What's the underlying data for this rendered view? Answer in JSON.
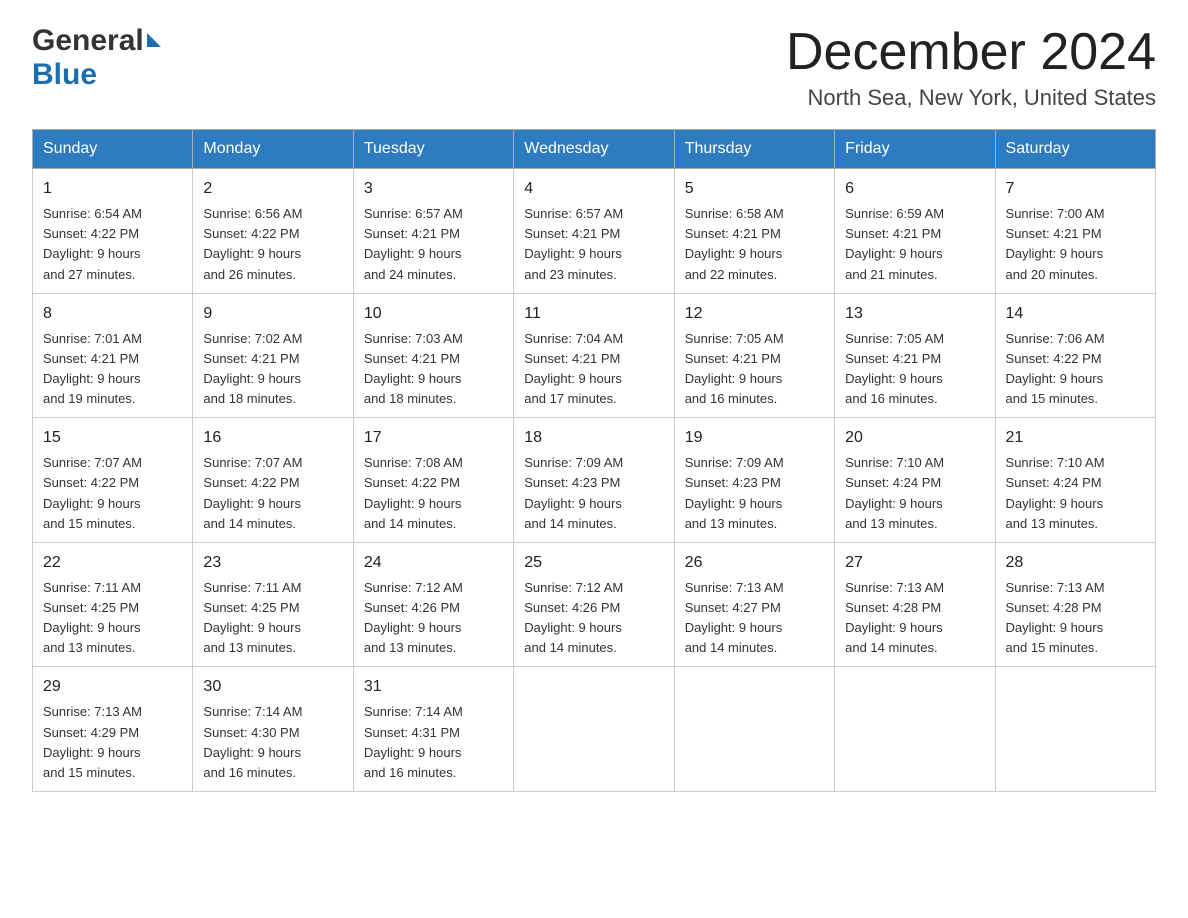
{
  "header": {
    "title": "December 2024",
    "subtitle": "North Sea, New York, United States",
    "logo_general": "General",
    "logo_blue": "Blue"
  },
  "days_of_week": [
    "Sunday",
    "Monday",
    "Tuesday",
    "Wednesday",
    "Thursday",
    "Friday",
    "Saturday"
  ],
  "weeks": [
    [
      {
        "day": "1",
        "sunrise": "6:54 AM",
        "sunset": "4:22 PM",
        "daylight": "9 hours and 27 minutes."
      },
      {
        "day": "2",
        "sunrise": "6:56 AM",
        "sunset": "4:22 PM",
        "daylight": "9 hours and 26 minutes."
      },
      {
        "day": "3",
        "sunrise": "6:57 AM",
        "sunset": "4:21 PM",
        "daylight": "9 hours and 24 minutes."
      },
      {
        "day": "4",
        "sunrise": "6:57 AM",
        "sunset": "4:21 PM",
        "daylight": "9 hours and 23 minutes."
      },
      {
        "day": "5",
        "sunrise": "6:58 AM",
        "sunset": "4:21 PM",
        "daylight": "9 hours and 22 minutes."
      },
      {
        "day": "6",
        "sunrise": "6:59 AM",
        "sunset": "4:21 PM",
        "daylight": "9 hours and 21 minutes."
      },
      {
        "day": "7",
        "sunrise": "7:00 AM",
        "sunset": "4:21 PM",
        "daylight": "9 hours and 20 minutes."
      }
    ],
    [
      {
        "day": "8",
        "sunrise": "7:01 AM",
        "sunset": "4:21 PM",
        "daylight": "9 hours and 19 minutes."
      },
      {
        "day": "9",
        "sunrise": "7:02 AM",
        "sunset": "4:21 PM",
        "daylight": "9 hours and 18 minutes."
      },
      {
        "day": "10",
        "sunrise": "7:03 AM",
        "sunset": "4:21 PM",
        "daylight": "9 hours and 18 minutes."
      },
      {
        "day": "11",
        "sunrise": "7:04 AM",
        "sunset": "4:21 PM",
        "daylight": "9 hours and 17 minutes."
      },
      {
        "day": "12",
        "sunrise": "7:05 AM",
        "sunset": "4:21 PM",
        "daylight": "9 hours and 16 minutes."
      },
      {
        "day": "13",
        "sunrise": "7:05 AM",
        "sunset": "4:21 PM",
        "daylight": "9 hours and 16 minutes."
      },
      {
        "day": "14",
        "sunrise": "7:06 AM",
        "sunset": "4:22 PM",
        "daylight": "9 hours and 15 minutes."
      }
    ],
    [
      {
        "day": "15",
        "sunrise": "7:07 AM",
        "sunset": "4:22 PM",
        "daylight": "9 hours and 15 minutes."
      },
      {
        "day": "16",
        "sunrise": "7:07 AM",
        "sunset": "4:22 PM",
        "daylight": "9 hours and 14 minutes."
      },
      {
        "day": "17",
        "sunrise": "7:08 AM",
        "sunset": "4:22 PM",
        "daylight": "9 hours and 14 minutes."
      },
      {
        "day": "18",
        "sunrise": "7:09 AM",
        "sunset": "4:23 PM",
        "daylight": "9 hours and 14 minutes."
      },
      {
        "day": "19",
        "sunrise": "7:09 AM",
        "sunset": "4:23 PM",
        "daylight": "9 hours and 13 minutes."
      },
      {
        "day": "20",
        "sunrise": "7:10 AM",
        "sunset": "4:24 PM",
        "daylight": "9 hours and 13 minutes."
      },
      {
        "day": "21",
        "sunrise": "7:10 AM",
        "sunset": "4:24 PM",
        "daylight": "9 hours and 13 minutes."
      }
    ],
    [
      {
        "day": "22",
        "sunrise": "7:11 AM",
        "sunset": "4:25 PM",
        "daylight": "9 hours and 13 minutes."
      },
      {
        "day": "23",
        "sunrise": "7:11 AM",
        "sunset": "4:25 PM",
        "daylight": "9 hours and 13 minutes."
      },
      {
        "day": "24",
        "sunrise": "7:12 AM",
        "sunset": "4:26 PM",
        "daylight": "9 hours and 13 minutes."
      },
      {
        "day": "25",
        "sunrise": "7:12 AM",
        "sunset": "4:26 PM",
        "daylight": "9 hours and 14 minutes."
      },
      {
        "day": "26",
        "sunrise": "7:13 AM",
        "sunset": "4:27 PM",
        "daylight": "9 hours and 14 minutes."
      },
      {
        "day": "27",
        "sunrise": "7:13 AM",
        "sunset": "4:28 PM",
        "daylight": "9 hours and 14 minutes."
      },
      {
        "day": "28",
        "sunrise": "7:13 AM",
        "sunset": "4:28 PM",
        "daylight": "9 hours and 15 minutes."
      }
    ],
    [
      {
        "day": "29",
        "sunrise": "7:13 AM",
        "sunset": "4:29 PM",
        "daylight": "9 hours and 15 minutes."
      },
      {
        "day": "30",
        "sunrise": "7:14 AM",
        "sunset": "4:30 PM",
        "daylight": "9 hours and 16 minutes."
      },
      {
        "day": "31",
        "sunrise": "7:14 AM",
        "sunset": "4:31 PM",
        "daylight": "9 hours and 16 minutes."
      },
      null,
      null,
      null,
      null
    ]
  ],
  "labels": {
    "sunrise": "Sunrise:",
    "sunset": "Sunset:",
    "daylight": "Daylight:"
  }
}
